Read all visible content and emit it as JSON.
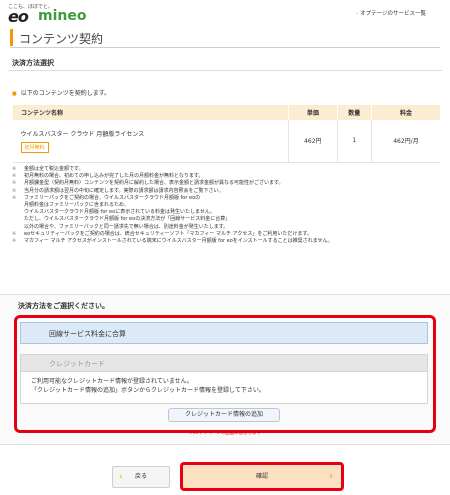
{
  "header": {
    "logo_tagline": "ここも、ほぼでと。",
    "logo_eo": "eo",
    "logo_mineo": "mineo",
    "service_link": "オプテージのサービス一覧"
  },
  "page_title": "コンテンツ契約",
  "section_title": "決済方法選択",
  "intro": "以下のコンテンツを契約します。",
  "table": {
    "headers": [
      "コンテンツ名称",
      "単価",
      "数量",
      "料金"
    ],
    "rows": [
      {
        "name": "ウイルスバスター クラウド 月額版ライセンス",
        "badge": "初月無料",
        "price": "462円",
        "qty": "1",
        "fee": "462円/月"
      }
    ]
  },
  "notes": [
    "金額は全て税込金額です。",
    "初月無料の場合、初めての申し込みが完了した月の月額料金が無料となります。",
    "月額課金型（契約月無料）コンテンツを契約月に解約した場合、表示金額と請求金額が異なる可能性がございます。",
    "当月分の請求額は翌月の中旬に確定します。実際の請求額は請求内容照会をご覧下さい。",
    "ファミリーパックをご契約の場合、ウイルスバスタークラウド月額版 for eoの\n月額料金はファミリーパックに含まれるため、\nウイルスバスタークラウド月額版 for eoに表示されている料金は発生いたしません。\nただし、ウイルスバスタークラウド月額版 for eoの決済方法が「回線サービス料金に合算」\n以外の場合や、ファミリーパックと同一請求先で無い場合は、別途料金が発生いたします。",
    "eoセキュリティーパックをご契約の場合は、統合セキュリティーソフト「マカフィー マルチ アクセス」をご利用いただけます。",
    "マカフィー マルチ アクセスがインストールされている端末にウイルスバスター月額版 for eoをインストールすることは推奨されません。"
  ],
  "payment": {
    "heading": "決済方法をご選択ください。",
    "option_line": "回線サービス料金に合算",
    "option_card": "クレジットカード",
    "card_message_1": "ご利用可能なクレジットカード情報が登録されていません。",
    "card_message_2": "「クレジットカード情報の追加」ボタンからクレジットカード情報を登録して下さい。",
    "add_card_button": "クレジットカード情報の追加",
    "small_note": "※eoマイページの画面に遷移します"
  },
  "footer": {
    "back_label": "戻る",
    "confirm_label": "確認"
  },
  "colors": {
    "accent_orange": "#f39800",
    "highlight_red": "#e60012",
    "brand_green": "#3d9c3b"
  }
}
